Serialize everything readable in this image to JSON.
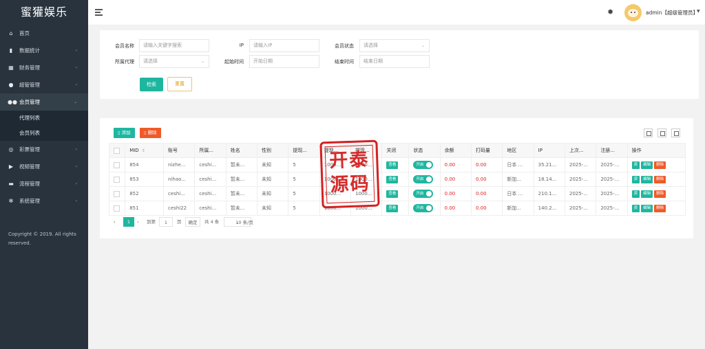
{
  "app": {
    "logo": "蜜獾娱乐"
  },
  "sidebar": {
    "items": [
      {
        "label": "首页",
        "icon": "home-icon"
      },
      {
        "label": "数据统计",
        "icon": "bar-chart-icon"
      },
      {
        "label": "财务管理",
        "icon": "bank-icon"
      },
      {
        "label": "超管管理",
        "icon": "user-icon"
      },
      {
        "label": "会员管理",
        "icon": "users-icon",
        "open": true,
        "children": [
          "代理列表",
          "会员列表"
        ]
      },
      {
        "label": "彩票管理",
        "icon": "gamepad-icon"
      },
      {
        "label": "视频管理",
        "icon": "video-icon"
      },
      {
        "label": "流程管理",
        "icon": "ticket-icon"
      },
      {
        "label": "系统管理",
        "icon": "gear-icon"
      }
    ],
    "copyright": "Copyright © 2019. All rights reserved."
  },
  "header": {
    "user": "admin【超级管理员】"
  },
  "search": {
    "member_name_label": "会员名称",
    "member_name_placeholder": "请输入关键字搜索",
    "ip_label": "IP",
    "ip_placeholder": "请输入IP",
    "status_label": "会员状态",
    "status_placeholder": "请选择",
    "agent_label": "所属代理",
    "agent_placeholder": "请选择",
    "start_label": "起始时间",
    "start_placeholder": "开始日期",
    "end_label": "结束时间",
    "end_placeholder": "结束日期",
    "search_button": "检索",
    "reset_button": "重置"
  },
  "toolbar": {
    "add": "添加",
    "delete": "删除"
  },
  "table": {
    "columns": [
      "MID",
      "账号",
      "所属...",
      "姓名",
      "性别",
      "提现...",
      "提现...",
      "提现...",
      "关闭",
      "状态",
      "余额",
      "打码量",
      "地区",
      "IP",
      "上次...",
      "注册...",
      "操作"
    ],
    "rows": [
      {
        "mid": "854",
        "account": "nizhe...",
        "agent": "ceshi...",
        "name": "暂未...",
        "gender": "未知",
        "c1": "5",
        "c2": "1000...",
        "c3": "1000...",
        "btn": "查看",
        "status": "开启",
        "balance": "0.00",
        "code": "0.00",
        "region": "日本 ...",
        "ip": "35.21...",
        "last": "2025-...",
        "reg": "2025-..."
      },
      {
        "mid": "853",
        "account": "nihao...",
        "agent": "ceshi...",
        "name": "暂未...",
        "gender": "未知",
        "c1": "5",
        "c2": "1000...",
        "c3": "1000...",
        "btn": "查看",
        "status": "开启",
        "balance": "0.00",
        "code": "0.00",
        "region": "新加...",
        "ip": "18.14...",
        "last": "2025-...",
        "reg": "2025-..."
      },
      {
        "mid": "852",
        "account": "ceshi...",
        "agent": "ceshi...",
        "name": "暂未...",
        "gender": "未知",
        "c1": "5",
        "c2": "1000...",
        "c3": "1000...",
        "btn": "查看",
        "status": "开启",
        "balance": "0.00",
        "code": "0.00",
        "region": "日本 ...",
        "ip": "210.1...",
        "last": "2025-...",
        "reg": "2025-..."
      },
      {
        "mid": "851",
        "account": "ceshi22",
        "agent": "ceshi...",
        "name": "暂未...",
        "gender": "未知",
        "c1": "5",
        "c2": "1000...",
        "c3": "1000...",
        "btn": "查看",
        "status": "开启",
        "balance": "0.00",
        "code": "0.00",
        "region": "新加...",
        "ip": "140.2...",
        "last": "2025-...",
        "reg": "2025-..."
      }
    ],
    "ops": {
      "view": "资",
      "edit": "编辑",
      "del": "删除"
    }
  },
  "pager": {
    "current": "1",
    "goto": "到第",
    "page_value": "1",
    "page_unit": "页",
    "confirm": "确定",
    "total": "共 4 条",
    "per_page": "10 条/页"
  },
  "watermark": {
    "text": "开泰源码"
  },
  "colors": {
    "sidebar": "#28333e",
    "accent": "#1fb69f",
    "danger": "#f05a28",
    "stamp": "#d42020"
  }
}
